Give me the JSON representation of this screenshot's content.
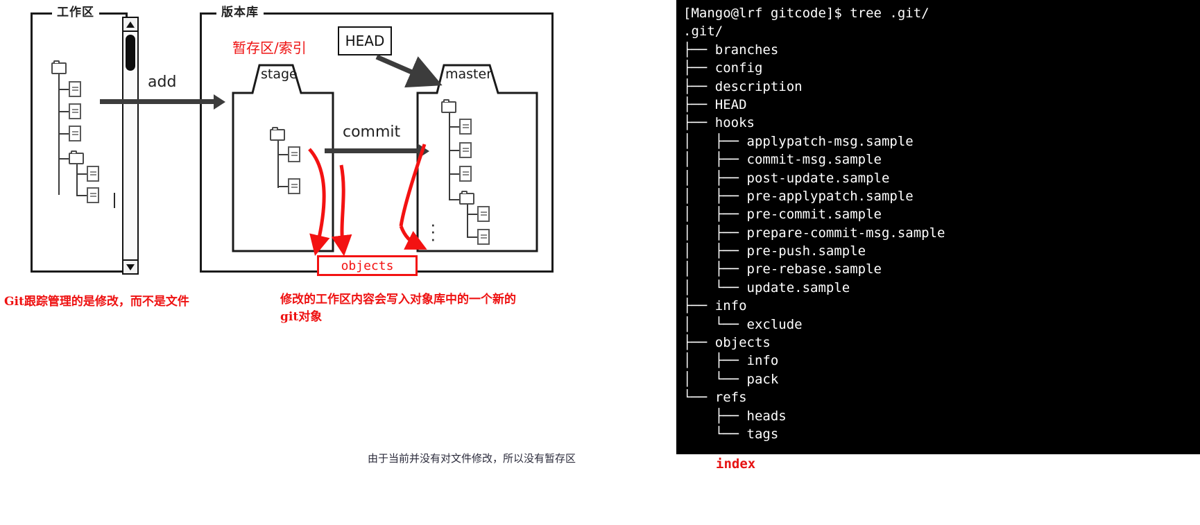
{
  "diagram": {
    "workspace_label": "工作区",
    "repo_label": "版本库",
    "stage_index_label": "暂存区/索引",
    "head_label": "HEAD",
    "stage_label": "stage",
    "master_label": "master",
    "add_label": "add",
    "commit_label": "commit",
    "objects_label": "objects",
    "ellipsis": "· · ·",
    "colors": {
      "red_annotation": "#ee1111",
      "arrow_gray": "#3c3c3c",
      "ink_black": "#1a1a1a"
    }
  },
  "annotations": {
    "left_red": "Git跟踪管理的是修改，而不是文件",
    "right_red_line1": "修改的工作区内容会写入对象库中的一个新的",
    "right_red_line2": "git对象",
    "bottom_note": "由于当前并没有对文件修改，所以没有暂存区",
    "index_red": "index"
  },
  "terminal": {
    "prompt": "[Mango@lrf gitcode]$ tree .git/",
    "lines": [
      "[Mango@lrf gitcode]$ tree .git/",
      ".git/",
      "├── branches",
      "├── config",
      "├── description",
      "├── HEAD",
      "├── hooks",
      "│   ├── applypatch-msg.sample",
      "│   ├── commit-msg.sample",
      "│   ├── post-update.sample",
      "│   ├── pre-applypatch.sample",
      "│   ├── pre-commit.sample",
      "│   ├── prepare-commit-msg.sample",
      "│   ├── pre-push.sample",
      "│   ├── pre-rebase.sample",
      "│   └── update.sample",
      "├── info",
      "│   └── exclude",
      "├── objects",
      "│   ├── info",
      "│   └── pack",
      "└── refs",
      "    ├── heads",
      "    └── tags"
    ],
    "background": "#000000",
    "foreground": "#ffffff"
  }
}
